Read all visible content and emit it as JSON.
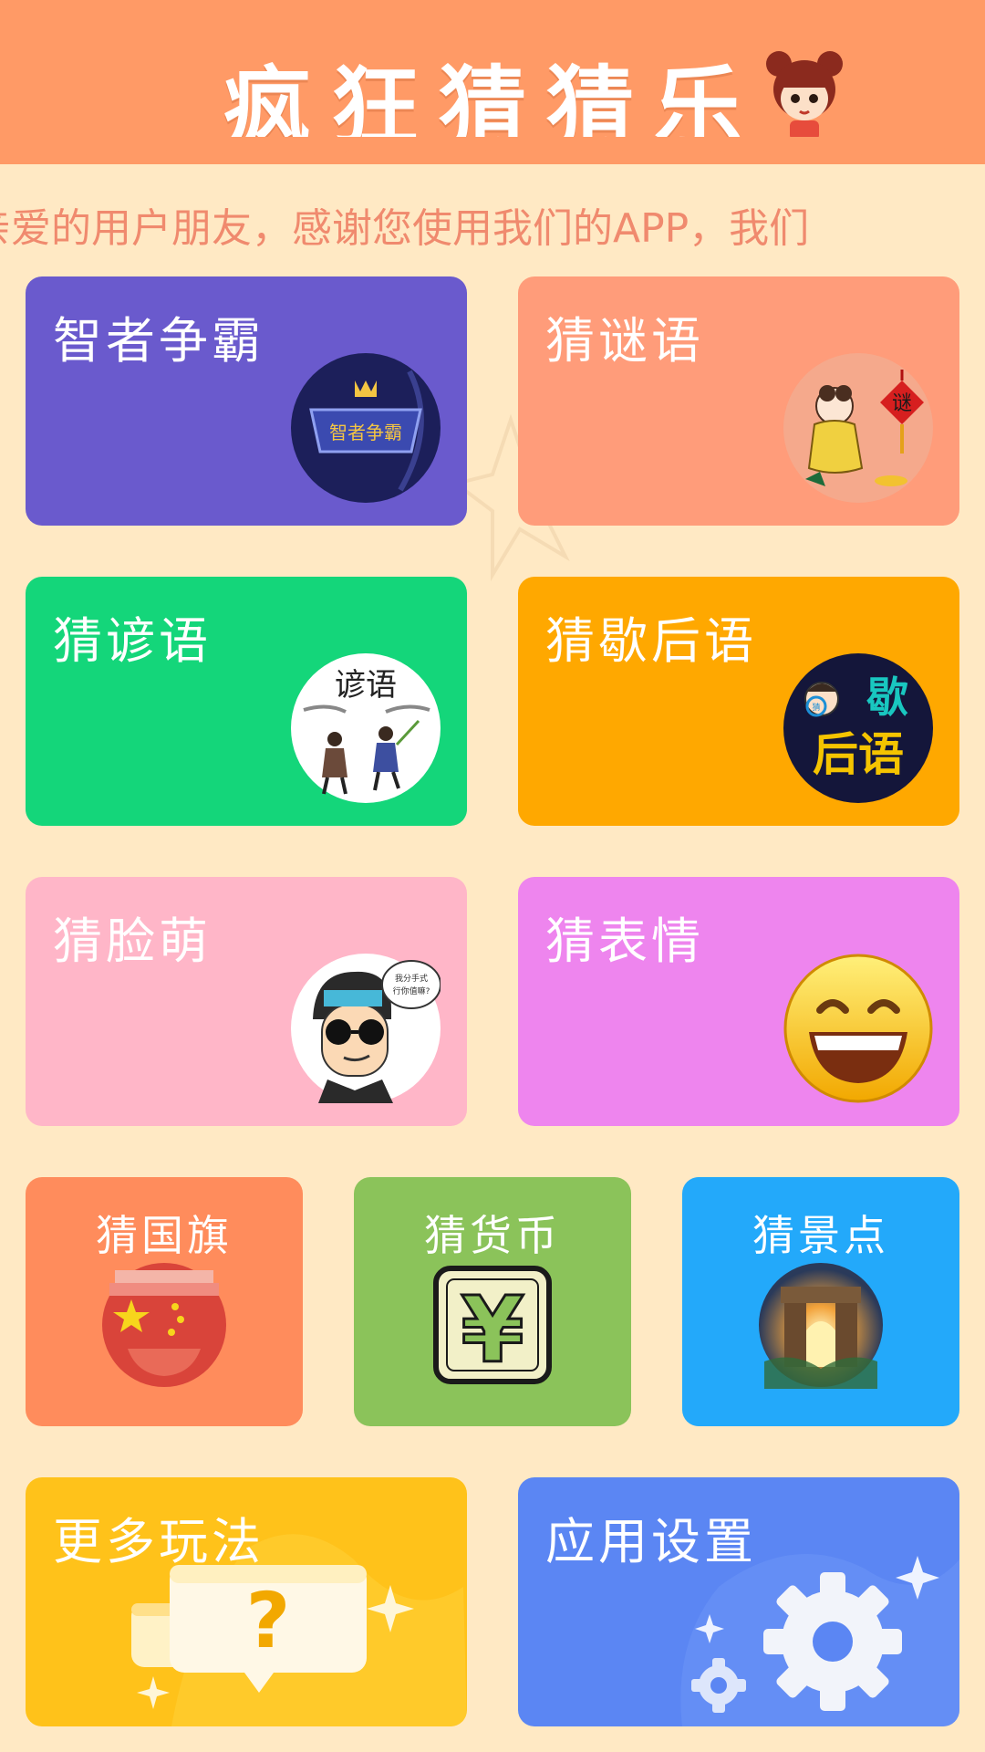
{
  "app": {
    "title": "疯狂猜猜乐",
    "marquee": "亲爱的用户朋友，感谢您使用我们的APP，我们"
  },
  "colors": {
    "background": "#FFE9C4",
    "header": "#FF9A66",
    "marquee_text": "#F08A6E"
  },
  "cards": [
    {
      "label": "智者争霸",
      "color": "#6A5ACD",
      "icon": "crown-badge-icon",
      "badge_text": "智者争霸"
    },
    {
      "label": "猜谜语",
      "color": "#FF9C7A",
      "icon": "riddle-lantern-icon",
      "badge_text": "谜"
    },
    {
      "label": "猜谚语",
      "color": "#14D67A",
      "icon": "proverb-figures-icon",
      "badge_text": "谚语"
    },
    {
      "label": "猜歇后语",
      "color": "#FFA800",
      "icon": "xiehouyu-badge-icon",
      "badge_text_top": "歇",
      "badge_text_bottom": "后语",
      "badge_tag": "猜"
    },
    {
      "label": "猜脸萌",
      "color": "#FFB6C8",
      "icon": "cartoon-face-icon",
      "bubble_line1": "我分手式",
      "bubble_line2": "行你值嘛?"
    },
    {
      "label": "猜表情",
      "color": "#EE85EE",
      "icon": "grin-emoji-icon"
    },
    {
      "label": "猜国旗",
      "color": "#FF8C5C",
      "icon": "flag-icon"
    },
    {
      "label": "猜货币",
      "color": "#8BC35A",
      "icon": "yen-icon",
      "symbol": "¥"
    },
    {
      "label": "猜景点",
      "color": "#23A9FA",
      "icon": "arch-landmark-icon"
    },
    {
      "label": "更多玩法",
      "color": "#FFC21A",
      "icon": "question-bubble-icon",
      "symbol": "?"
    },
    {
      "label": "应用设置",
      "color": "#5B86F3",
      "icon": "gear-icon"
    }
  ]
}
